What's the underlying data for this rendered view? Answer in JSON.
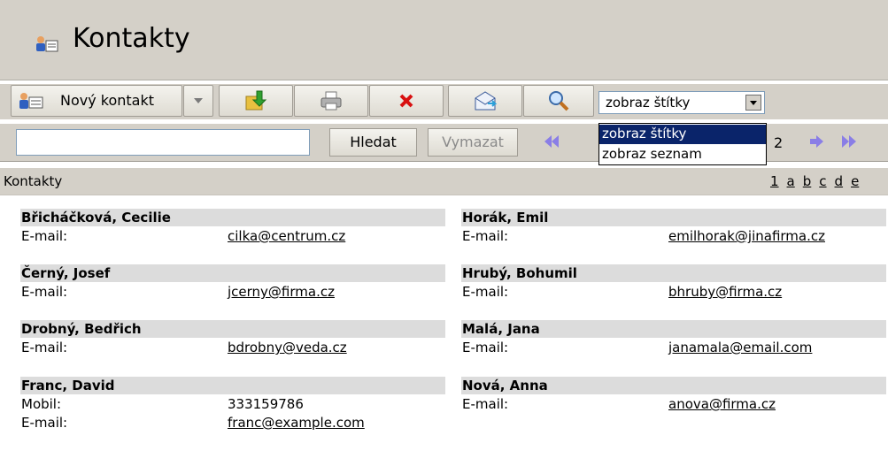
{
  "window": {
    "title": "Kontakty"
  },
  "toolbar": {
    "new_contact_label": "Nový kontakt",
    "view_select_value": "zobraz štítky",
    "view_options": [
      "zobraz štítky",
      "zobraz seznam"
    ]
  },
  "search": {
    "value": "",
    "search_label": "Hledat",
    "clear_label": "Vymazat",
    "page_number": "2"
  },
  "section": {
    "title": "Kontakty",
    "letters": [
      "1",
      "a",
      "b",
      "c",
      "d",
      "e"
    ]
  },
  "contacts_left": [
    {
      "name": "Břicháčková, Cecilie",
      "rows": [
        {
          "label": "E-mail:",
          "value": "cilka@centrum.cz",
          "link": true
        }
      ]
    },
    {
      "name": "Černý, Josef",
      "rows": [
        {
          "label": "E-mail:",
          "value": "jcerny@firma.cz",
          "link": true
        }
      ]
    },
    {
      "name": "Drobný, Bedřich",
      "rows": [
        {
          "label": "E-mail:",
          "value": "bdrobny@veda.cz",
          "link": true
        }
      ]
    },
    {
      "name": "Franc, David",
      "rows": [
        {
          "label": "Mobil:",
          "value": "333159786",
          "link": false
        },
        {
          "label": "E-mail:",
          "value": "franc@example.com",
          "link": true
        }
      ]
    }
  ],
  "contacts_right": [
    {
      "name": "Horák, Emil",
      "rows": [
        {
          "label": "E-mail:",
          "value": "emilhorak@jinafirma.cz",
          "link": true
        }
      ]
    },
    {
      "name": "Hrubý, Bohumil",
      "rows": [
        {
          "label": "E-mail:",
          "value": "bhruby@firma.cz",
          "link": true
        }
      ]
    },
    {
      "name": "Malá, Jana",
      "rows": [
        {
          "label": "E-mail:",
          "value": "janamala@email.com",
          "link": true
        }
      ]
    },
    {
      "name": "Nová, Anna",
      "rows": [
        {
          "label": "E-mail:",
          "value": "anova@firma.cz",
          "link": true
        }
      ]
    }
  ],
  "icons": {
    "title": "contacts-icon",
    "new_contact": "contacts-icon",
    "import": "import-icon",
    "print": "printer-icon",
    "delete": "delete-icon",
    "mail": "envelope-icon",
    "search": "magnifier-icon",
    "first_page": "double-arrow-left-icon",
    "next_page": "arrow-right-icon",
    "last_page": "double-arrow-right-icon"
  },
  "colors": {
    "chrome": "#d4d0c8",
    "card_header": "#dcdcdc",
    "selection": "#0a246a",
    "nav_arrow": "#8a7ee6"
  }
}
